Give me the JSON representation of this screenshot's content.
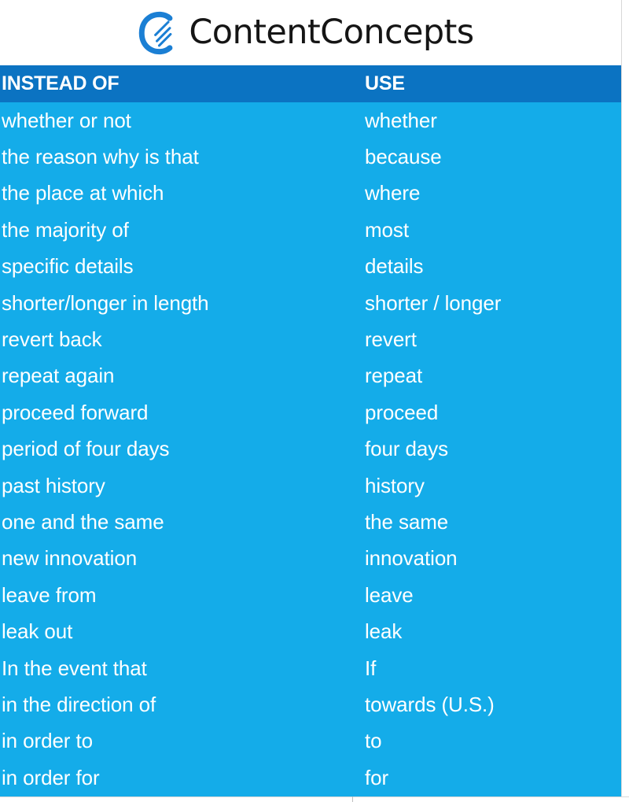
{
  "brand": {
    "name": "ContentConcepts",
    "logo_icon": "contentconcepts-c-mark",
    "logo_color": "#1b7fd4",
    "wordmark_color": "#151515"
  },
  "theme": {
    "header_blue": "#0b73c2",
    "body_blue": "#14ace9",
    "text_white": "#ffffff",
    "page_white": "#ffffff"
  },
  "table": {
    "columns": [
      {
        "key": "instead_of",
        "label": "INSTEAD OF"
      },
      {
        "key": "use",
        "label": "USE"
      }
    ],
    "rows": [
      {
        "instead_of": "whether or not",
        "use": "whether"
      },
      {
        "instead_of": "the reason why is that",
        "use": "because"
      },
      {
        "instead_of": "the place at which",
        "use": "where"
      },
      {
        "instead_of": "the majority of",
        "use": "most"
      },
      {
        "instead_of": "specific details",
        "use": "details"
      },
      {
        "instead_of": "shorter/longer in length",
        "use": "shorter / longer"
      },
      {
        "instead_of": "revert back",
        "use": "revert"
      },
      {
        "instead_of": "repeat again",
        "use": "repeat"
      },
      {
        "instead_of": "proceed forward",
        "use": "proceed"
      },
      {
        "instead_of": "period of four days",
        "use": "four days"
      },
      {
        "instead_of": "past history",
        "use": "history"
      },
      {
        "instead_of": "one and the same",
        "use": "the same"
      },
      {
        "instead_of": "new innovation",
        "use": "innovation"
      },
      {
        "instead_of": "leave from",
        "use": "leave"
      },
      {
        "instead_of": "leak out",
        "use": "leak"
      },
      {
        "instead_of": "In the event that",
        "use": "If"
      },
      {
        "instead_of": "in the direction of",
        "use": "towards (U.S.)"
      },
      {
        "instead_of": "in order to",
        "use": "to"
      },
      {
        "instead_of": "in order for",
        "use": "for"
      }
    ]
  }
}
